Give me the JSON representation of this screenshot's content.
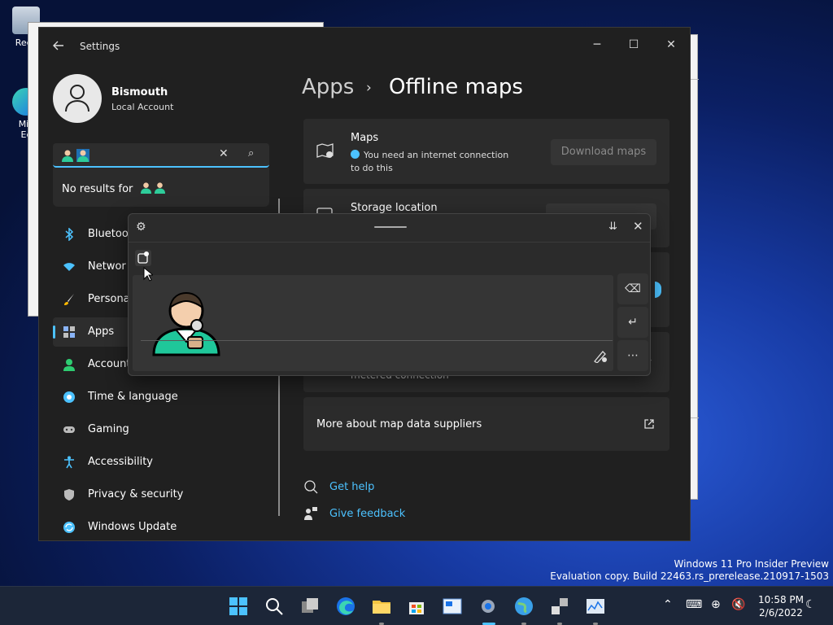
{
  "desktop": {
    "icons": [
      {
        "label": "Recy"
      },
      {
        "label": "Mic\nEc"
      }
    ]
  },
  "window": {
    "title": "Settings",
    "controls": {
      "minimize": "─",
      "maximize": "☐",
      "close": "✕"
    }
  },
  "user": {
    "name": "Bismouth",
    "account_type": "Local Account"
  },
  "search": {
    "value_emoji": [
      "person-emoji",
      "person-emoji-selected"
    ],
    "no_results_prefix": "No results for"
  },
  "nav": {
    "items": [
      {
        "label": "Bluetoo",
        "icon": "bluetooth-icon",
        "color": "#4cc2ff"
      },
      {
        "label": "Networ",
        "icon": "wifi-icon",
        "color": "#4cc2ff"
      },
      {
        "label": "Persona",
        "icon": "brush-icon",
        "color": "#ffb900"
      },
      {
        "label": "Apps",
        "icon": "apps-icon",
        "color": "#8ab4f8",
        "selected": true
      },
      {
        "label": "Account",
        "icon": "account-icon",
        "color": "#2ecc71"
      },
      {
        "label": "Time & language",
        "icon": "globe-clock-icon",
        "color": "#4cc2ff"
      },
      {
        "label": "Gaming",
        "icon": "gamepad-icon",
        "color": "#bbbbbb"
      },
      {
        "label": "Accessibility",
        "icon": "accessibility-icon",
        "color": "#4cc2ff"
      },
      {
        "label": "Privacy & security",
        "icon": "shield-icon",
        "color": "#bbbbbb"
      },
      {
        "label": "Windows Update",
        "icon": "update-icon",
        "color": "#4cc2ff"
      }
    ]
  },
  "breadcrumb": {
    "parent": "Apps",
    "separator": "›",
    "current": "Offline maps"
  },
  "maps_card": {
    "title": "Maps",
    "info": "You need an internet connection to do this",
    "button": "Download maps"
  },
  "storage_card": {
    "title": "Storage location"
  },
  "metered_card": {
    "partial_text": "metered connection"
  },
  "more_card": {
    "label": "More about map data suppliers"
  },
  "help": {
    "get_help": "Get help",
    "give_feedback": "Give feedback"
  },
  "pen_panel": {
    "gear": "⚙",
    "dock": "⇊",
    "close": "✕",
    "backspace": "⌫",
    "enter": "↵",
    "more": "⋯"
  },
  "watermark": {
    "line1": "Windows 11 Pro Insider Preview",
    "line2": "Evaluation copy. Build 22463.rs_prerelease.210917-1503"
  },
  "taskbar": {
    "time": "10:58 PM",
    "date": "2/6/2022"
  },
  "colors": {
    "accent": "#4cc2ff",
    "window_bg": "#202020",
    "card_bg": "#2b2b2b"
  }
}
